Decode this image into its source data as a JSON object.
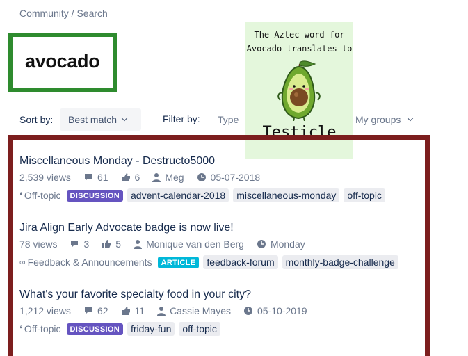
{
  "breadcrumb": "Community / Search",
  "search": {
    "value": "avocado"
  },
  "toolbar": {
    "sort_label": "Sort by:",
    "sort_value": "Best match",
    "filter_label": "Filter by:",
    "filter_type": "Type",
    "filter_groups": "My groups"
  },
  "meme": {
    "top_line1": "The Aztec word for",
    "top_line2": "Avocado translates to",
    "bottom": "Testicle"
  },
  "results": [
    {
      "title": "Miscellaneous Monday - Destructo5000",
      "views": "2,539 views",
      "comments": "61",
      "likes": "6",
      "author": "Meg",
      "date": "05-07-2018",
      "category": "Off-topic",
      "category_icon": "chat-icon",
      "badge": "DISCUSSION",
      "tags": [
        "advent-calendar-2018",
        "miscellaneous-monday",
        "off-topic"
      ]
    },
    {
      "title": "Jira Align Early Advocate badge is now live!",
      "views": "78 views",
      "comments": "3",
      "likes": "5",
      "author": "Monique van den Berg",
      "date": "Monday",
      "category": "Feedback & Announcements",
      "category_icon": "infinity-icon",
      "badge": "ARTICLE",
      "tags": [
        "feedback-forum",
        "monthly-badge-challenge"
      ]
    },
    {
      "title": "What's your favorite specialty food in your city?",
      "views": "1,212 views",
      "comments": "62",
      "likes": "11",
      "author": "Cassie Mayes",
      "date": "05-10-2019",
      "category": "Off-topic",
      "category_icon": "chat-icon",
      "badge": "DISCUSSION",
      "tags": [
        "friday-fun",
        "off-topic"
      ]
    }
  ],
  "colors": {
    "search_highlight": "#2e8b2e",
    "results_highlight": "#7c1e1e",
    "discussion_badge": "#6554c0",
    "article_badge": "#00b8d9"
  }
}
